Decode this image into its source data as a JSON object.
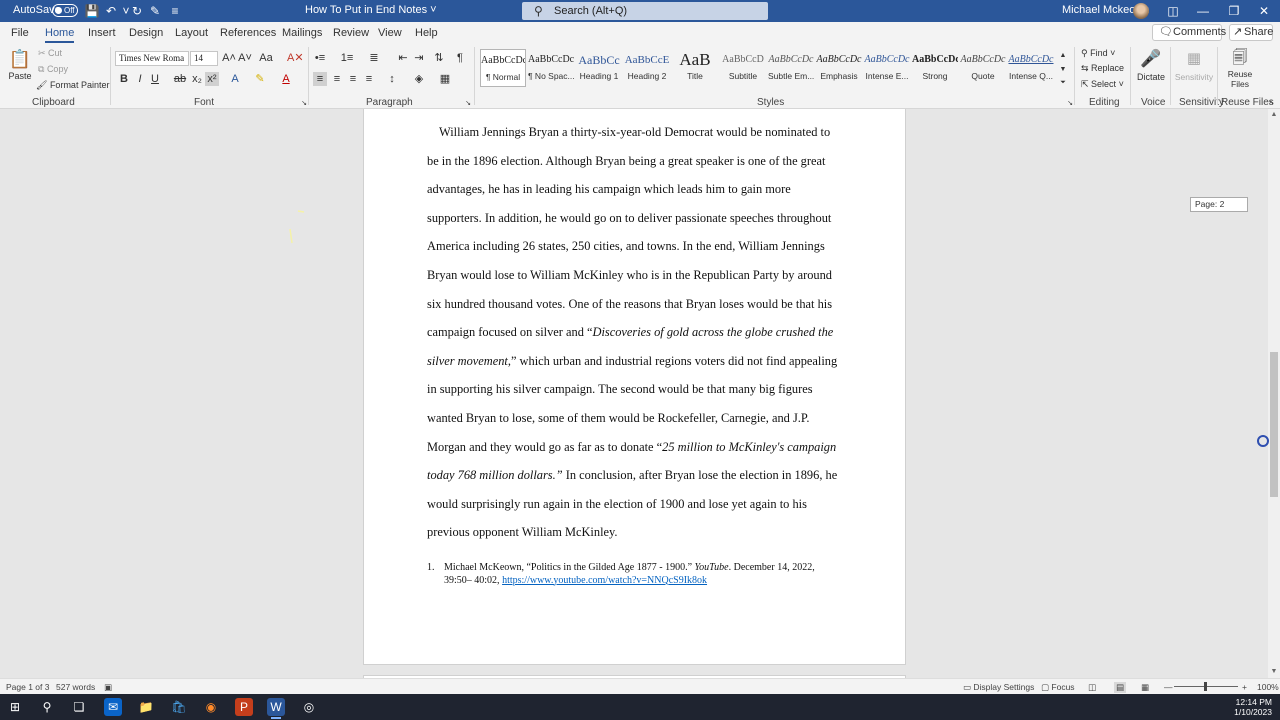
{
  "titlebar": {
    "autosave_label": "AutoSave",
    "autosave_state": "Off",
    "doc_title": "How To Put in End Notes",
    "search_placeholder": "Search (Alt+Q)",
    "user_name": "Michael Mckeown"
  },
  "tabs": [
    "File",
    "Home",
    "Insert",
    "Design",
    "Layout",
    "References",
    "Mailings",
    "Review",
    "View",
    "Help"
  ],
  "active_tab": "Home",
  "ribbon_right": {
    "comments": "Comments",
    "share": "Share"
  },
  "clipboard": {
    "paste": "Paste",
    "cut": "Cut",
    "copy": "Copy",
    "format_painter": "Format Painter",
    "label": "Clipboard"
  },
  "font": {
    "name": "Times New Roma",
    "size": "14",
    "label": "Font"
  },
  "paragraph": {
    "label": "Paragraph"
  },
  "styles": {
    "label": "Styles",
    "items": [
      {
        "sample": "AaBbCcDc",
        "name": "¶ Normal"
      },
      {
        "sample": "AaBbCcDc",
        "name": "¶ No Spac..."
      },
      {
        "sample": "AaBbCc",
        "name": "Heading 1"
      },
      {
        "sample": "AaBbCcE",
        "name": "Heading 2"
      },
      {
        "sample": "AaB",
        "name": "Title"
      },
      {
        "sample": "AaBbCcD",
        "name": "Subtitle"
      },
      {
        "sample": "AaBbCcDc",
        "name": "Subtle Em..."
      },
      {
        "sample": "AaBbCcDc",
        "name": "Emphasis"
      },
      {
        "sample": "AaBbCcDc",
        "name": "Intense E..."
      },
      {
        "sample": "AaBbCcDc",
        "name": "Strong"
      },
      {
        "sample": "AaBbCcDc",
        "name": "Quote"
      },
      {
        "sample": "AaBbCcDc",
        "name": "Intense Q..."
      }
    ]
  },
  "editing": {
    "find": "Find",
    "replace": "Replace",
    "select": "Select",
    "label": "Editing"
  },
  "voice": {
    "dictate": "Dictate",
    "label": "Voice"
  },
  "sensitivity": {
    "button": "Sensitivity",
    "label": "Sensitivity"
  },
  "reuse": {
    "button_line1": "Reuse",
    "button_line2": "Files",
    "label": "Reuse Files"
  },
  "document": {
    "lines": [
      "William Jennings Bryan a thirty-six-year-old Democrat would be nominated to",
      "be in the 1896 election. Although Bryan being a great speaker is one of the great",
      "advantages, he has in leading his campaign which leads him to gain more",
      "supporters. In addition, he would go on to deliver passionate speeches throughout",
      "America including 26 states, 250 cities, and towns. In the end, William Jennings",
      "Bryan would lose to William McKinley who is in the Republican Party by around",
      "six hundred thousand votes. One of the reasons that Bryan loses would be that his"
    ],
    "line8_plain": "campaign focused on silver and “",
    "line8_italic": "Discoveries of gold across the globe crushed the",
    "line9_italic": "silver movement",
    "line9_plain": ",” which urban and industrial regions voters did not find appealing",
    "lines_b": [
      "in supporting his silver campaign. The second would be that many big figures",
      "wanted Bryan to lose, some of them would be Rockefeller, Carnegie, and J.P."
    ],
    "line12_plain": "Morgan and they would go as far as to donate “",
    "line12_italic": "25 million to McKinley's campaign",
    "line13_italic": "today 768 million dollars.”",
    "line13_plain": " In conclusion, after Bryan lose the election in 1896, he",
    "lines_c": [
      "would surprisingly run again in the election of 1900 and lose yet again to his",
      "previous opponent William McKinley."
    ],
    "footnote_num": "1.",
    "footnote_pre": "Michael McKeown, “Politics in the Gilded Age 1877 - 1900.” ",
    "footnote_italic": "YouTube",
    "footnote_post": ". December 14, 2022, 39:50– 40:02, ",
    "footnote_link": "https://www.youtube.com/watch?v=NNQcS9Ik8ok",
    "page_tip": "Page: 2"
  },
  "status": {
    "page": "Page 1 of 3",
    "words": "527 words",
    "display_settings": "Display Settings",
    "focus": "Focus",
    "zoom": "100%"
  },
  "taskbar": {
    "time": "12:14 PM",
    "date": "1/10/2023"
  }
}
